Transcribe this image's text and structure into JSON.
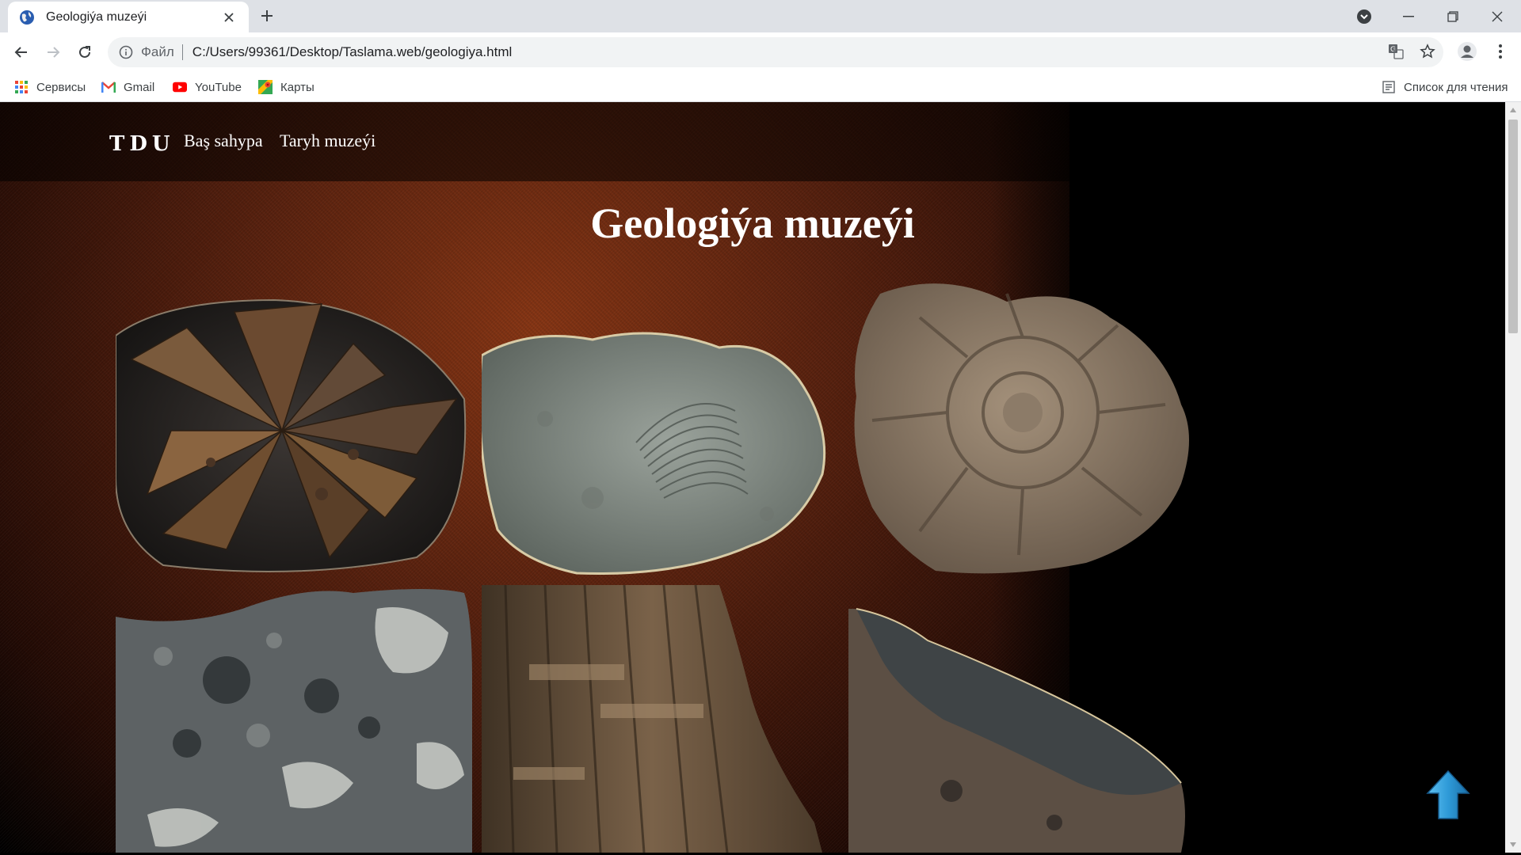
{
  "browser": {
    "tab_title": "Geologiýa muzeýi",
    "url_scheme_label": "Файл",
    "url": "C:/Users/99361/Desktop/Taslama.web/geologiya.html",
    "bookmarks": [
      {
        "label": "Сервисы",
        "icon": "apps-grid-icon"
      },
      {
        "label": "Gmail",
        "icon": "gmail-icon"
      },
      {
        "label": "YouTube",
        "icon": "youtube-icon"
      },
      {
        "label": "Карты",
        "icon": "maps-icon"
      }
    ],
    "reading_list_label": "Список для чтения"
  },
  "site": {
    "logo": "TDU",
    "nav": [
      {
        "label": "Baş sahypa"
      },
      {
        "label": "Taryh muzeýi"
      }
    ],
    "title": "Geologiýa muzeýi"
  },
  "gallery": [
    {
      "name": "shark-teeth-fossil",
      "icon": "fossil-teeth"
    },
    {
      "name": "ammonite-imprint-stone",
      "icon": "fossil-imprint"
    },
    {
      "name": "ammonite-fossil",
      "icon": "ammonite"
    },
    {
      "name": "granite-rock",
      "icon": "rock"
    },
    {
      "name": "petrified-wood",
      "icon": "wood"
    },
    {
      "name": "dark-stone-block",
      "icon": "stone"
    }
  ],
  "colors": {
    "accent_blue": "#2e9ad8",
    "header_bg": "#000000",
    "texture_brown": "#6b2a10"
  }
}
